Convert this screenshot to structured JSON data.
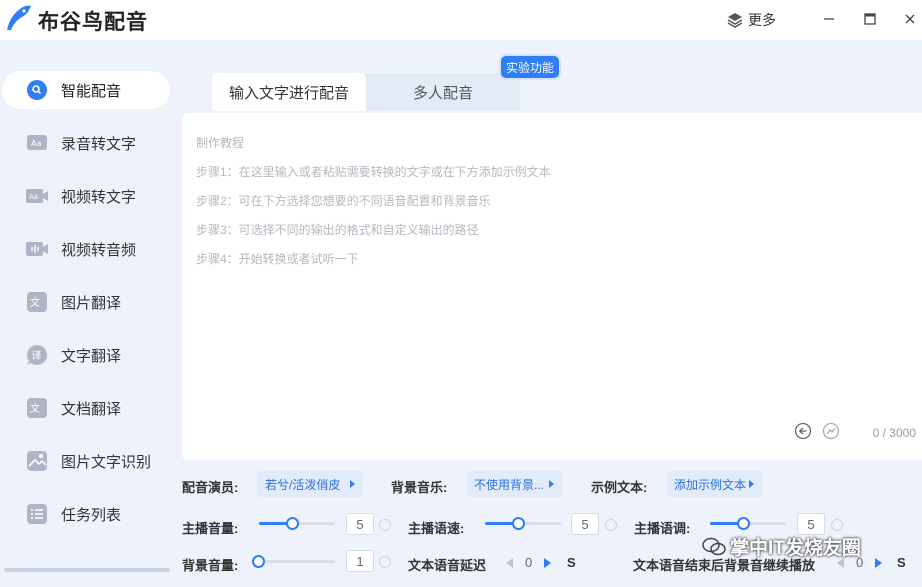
{
  "app": {
    "title": "布谷鸟配音",
    "more_label": "更多"
  },
  "colors": {
    "accent": "#2f7ef8",
    "sidebar_bg": "#eef3fb"
  },
  "sidebar": {
    "items": [
      {
        "label": "智能配音",
        "icon": "pin-icon",
        "active": true
      },
      {
        "label": "录音转文字",
        "icon": "aa-card-icon"
      },
      {
        "label": "视频转文字",
        "icon": "video-text-icon"
      },
      {
        "label": "视频转音频",
        "icon": "video-audio-icon"
      },
      {
        "label": "图片翻译",
        "icon": "image-translate-icon"
      },
      {
        "label": "文字翻译",
        "icon": "text-translate-icon"
      },
      {
        "label": "文档翻译",
        "icon": "doc-translate-icon"
      },
      {
        "label": "图片文字识别",
        "icon": "image-ocr-icon"
      },
      {
        "label": "任务列表",
        "icon": "task-list-icon"
      }
    ]
  },
  "tabs": [
    {
      "label": "输入文字进行配音",
      "active": true
    },
    {
      "label": "多人配音"
    }
  ],
  "badge": "实验功能",
  "editor": {
    "guide_title": "制作教程",
    "steps": [
      "步骤1：在这里输入或者粘贴需要转换的文字或在下方添加示例文本",
      "步骤2：可在下方选择您想要的不同语音配置和背景音乐",
      "步骤3：可选择不同的输出的格式和自定义输出的路径",
      "步骤4：开始转换或者试听一下"
    ],
    "counter": "0 / 3000"
  },
  "controls": {
    "voice_label": "配音演员:",
    "voice_value": "若兮/活泼俏皮",
    "bgm_label": "背景音乐:",
    "bgm_value": "不使用背景...",
    "sample_label": "示例文本:",
    "sample_value": "添加示例文本",
    "main_volume_label": "主播音量:",
    "main_volume": 5,
    "speed_label": "主播语速:",
    "speed": 5,
    "pitch_label": "主播语调:",
    "pitch": 5,
    "bg_volume_label": "背景音量:",
    "bg_volume": 1,
    "delay_label": "文本语音延迟",
    "delay_value": "0",
    "delay_unit": "S",
    "continue_label": "文本语音结束后背景音继续播放",
    "continue_value": "0",
    "continue_unit": "S"
  },
  "watermark": "掌中IT发烧友圈"
}
